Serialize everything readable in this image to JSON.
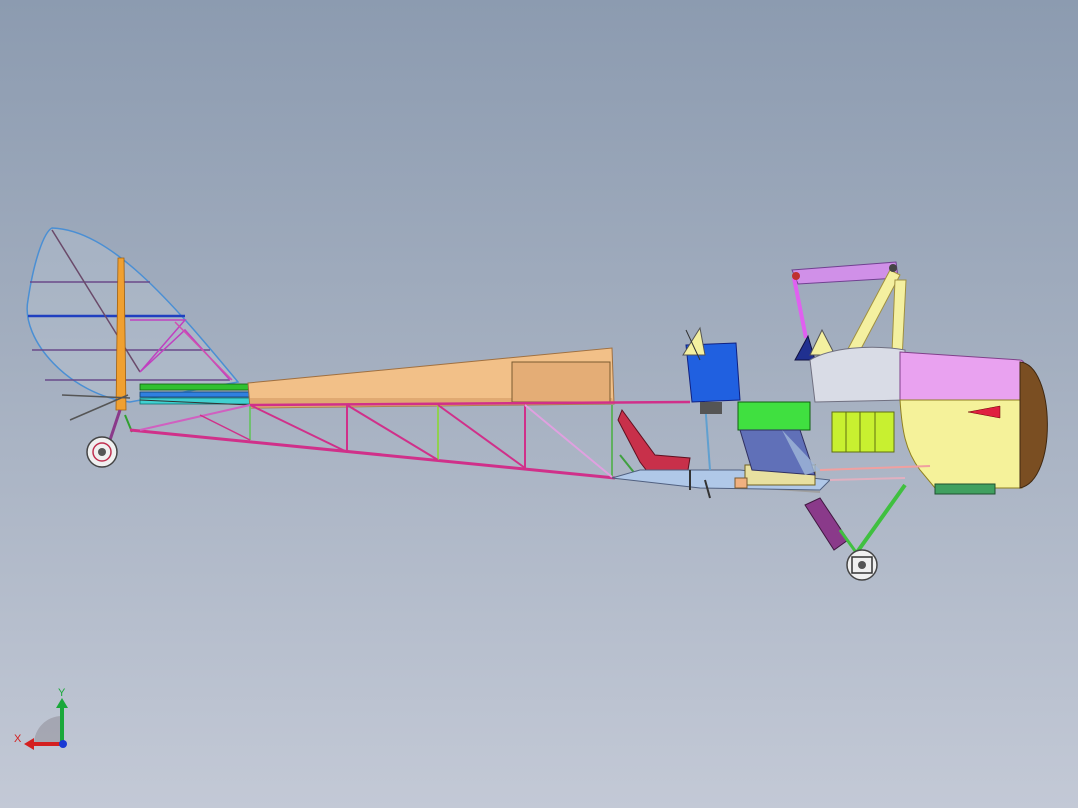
{
  "viewport": {
    "background_top": "#8c9bb0",
    "background_bottom": "#c3c9d6"
  },
  "model": {
    "description_icon": "aircraft-assembly",
    "colors": {
      "tail_outline": "#4a8fd4",
      "tail_spar": "#f0a030",
      "fuselage_cover": "#f2c088",
      "truss_magenta": "#d0308a",
      "truss_green": "#60c060",
      "cowling_yellow": "#f5f29a",
      "cowling_pink": "#e9a2f0",
      "nose_brown": "#7a4e22",
      "seat_red": "#c8304a",
      "instrument_blue": "#2060e0",
      "panel_green": "#40e040",
      "wing_strut_pink": "#e080f0",
      "wing_strut_yellow": "#f4f0a0",
      "wheel_gray": "#e0e0e0",
      "landing_gear_green": "#40c040",
      "battery_purple": "#8a3a8a"
    }
  },
  "triad": {
    "x_label": "X",
    "y_label": "Y",
    "x_color": "#d42020",
    "y_color": "#1aa83a",
    "z_color": "#1a3ad4"
  }
}
